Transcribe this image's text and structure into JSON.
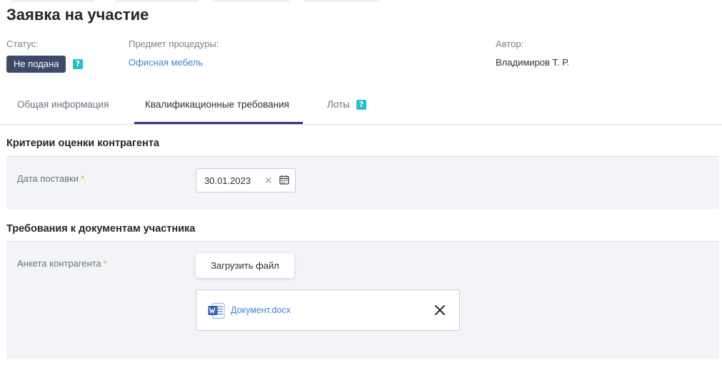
{
  "page": {
    "title": "Заявка на участие"
  },
  "meta": {
    "status_label": "Статус:",
    "status_value": "Не подана",
    "subject_label": "Предмет процедуры:",
    "subject_value": "Офисная мебель",
    "author_label": "Автор:",
    "author_value": "Владимиров Т. Р.",
    "help_glyph": "?"
  },
  "tabs": [
    {
      "label": "Общая информация"
    },
    {
      "label": "Квалификационные требования",
      "active": true
    },
    {
      "label": "Лоты",
      "has_help": true
    }
  ],
  "sections": {
    "criteria": {
      "title": "Критерии оценки контрагента",
      "delivery_date_label": "Дата поставки",
      "delivery_date_value": "30.01.2023"
    },
    "documents": {
      "title": "Требования к документам участника",
      "questionnaire_label": "Анкета контрагента",
      "upload_button": "Загрузить файл",
      "file_name": "Документ.docx"
    }
  },
  "required_mark": "*",
  "icons": {
    "help": "help-icon",
    "clear": "clear-icon",
    "calendar": "calendar-icon",
    "word_file": "word-file-icon",
    "remove": "close-icon"
  },
  "colors": {
    "status_badge": "#3d4a6b",
    "help_badge": "#23c0c9",
    "link": "#3c82d4",
    "tab_active_underline": "#3e2f8a",
    "required": "#f0a030",
    "section_background": "#f3f4f8"
  }
}
